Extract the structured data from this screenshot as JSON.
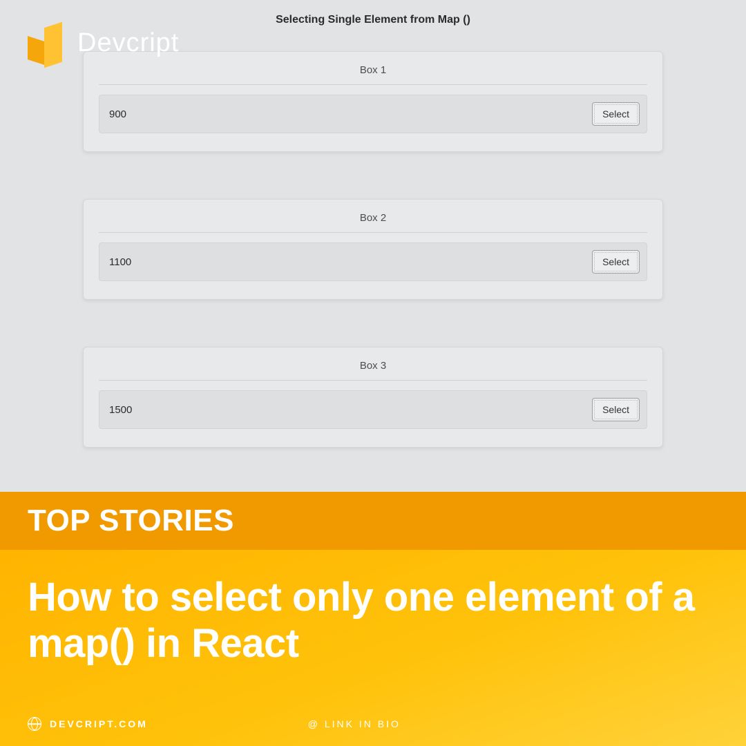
{
  "brand": {
    "name": "Devcript"
  },
  "app": {
    "title": "Selecting Single Element from Map ()",
    "select_label": "Select",
    "boxes": [
      {
        "label": "Box 1",
        "value": "900"
      },
      {
        "label": "Box 2",
        "value": "1100"
      },
      {
        "label": "Box 3",
        "value": "1500"
      }
    ]
  },
  "banner": {
    "kicker": "TOP STORIES",
    "headline": "How to select only one element of a map() in React",
    "site": "DEVCRIPT.COM",
    "link_text": "@ LINK IN BIO"
  }
}
